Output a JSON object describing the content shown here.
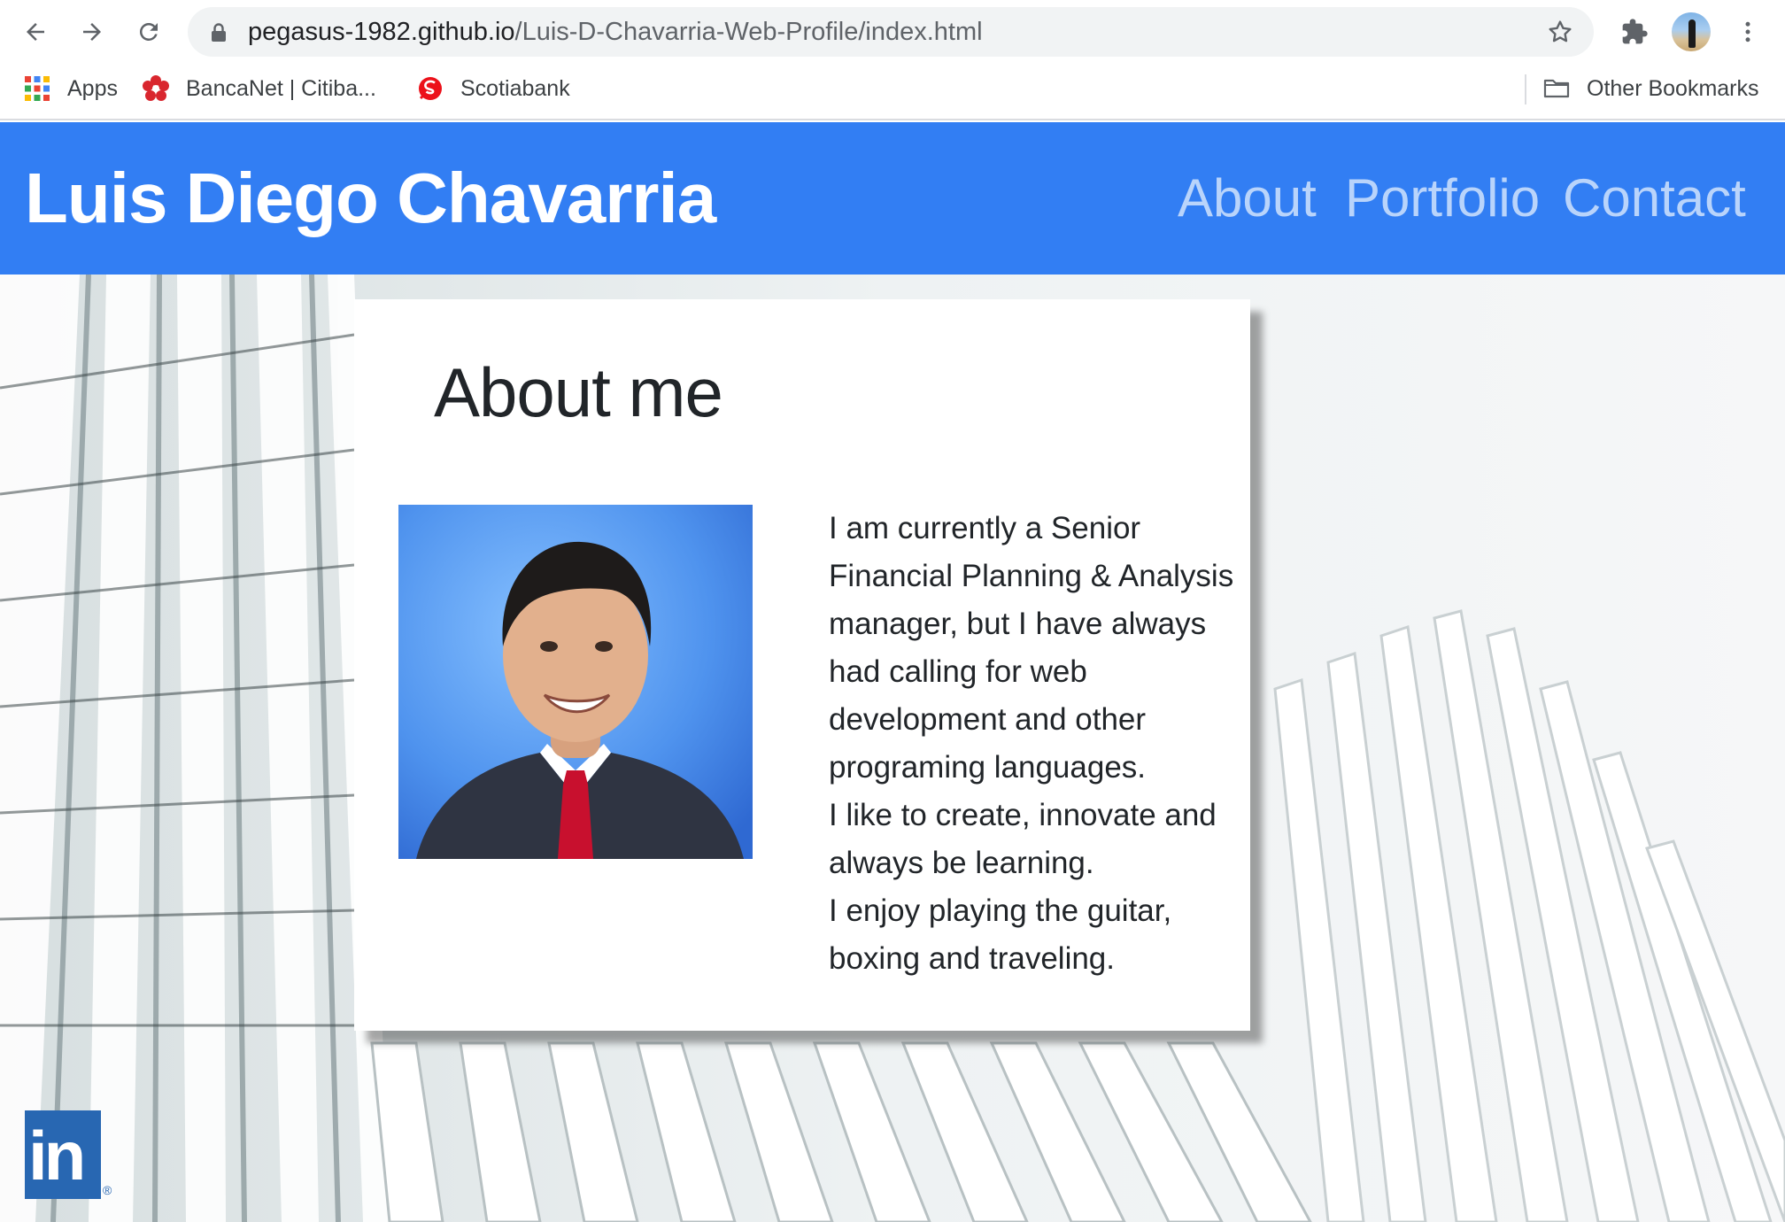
{
  "browser": {
    "url_host": "pegasus-1982.github.io",
    "url_path": "/Luis-D-Chavarria-Web-Profile/index.html",
    "bookmarks": [
      {
        "label": "Apps"
      },
      {
        "label": "BancaNet | Citiba..."
      },
      {
        "label": "Scotiabank"
      }
    ],
    "other_bookmarks": "Other Bookmarks"
  },
  "navbar": {
    "brand": "Luis Diego Chavarria",
    "links": [
      "About",
      "Portfolio",
      "Contact"
    ]
  },
  "about": {
    "title": "About me",
    "paragraphs": [
      "I am currently a Senior Financial Planning & Analysis manager, but I have always had calling for web development and other programing languages.",
      "I like to create, innovate and always be learning.",
      "I enjoy playing the guitar, boxing and traveling."
    ]
  },
  "footer": {
    "linkedin_text": "in",
    "registered_mark": "®"
  },
  "colors": {
    "navbar": "#327ef3",
    "nav_link": "#b9d4fb",
    "linkedin": "#2867b2"
  }
}
